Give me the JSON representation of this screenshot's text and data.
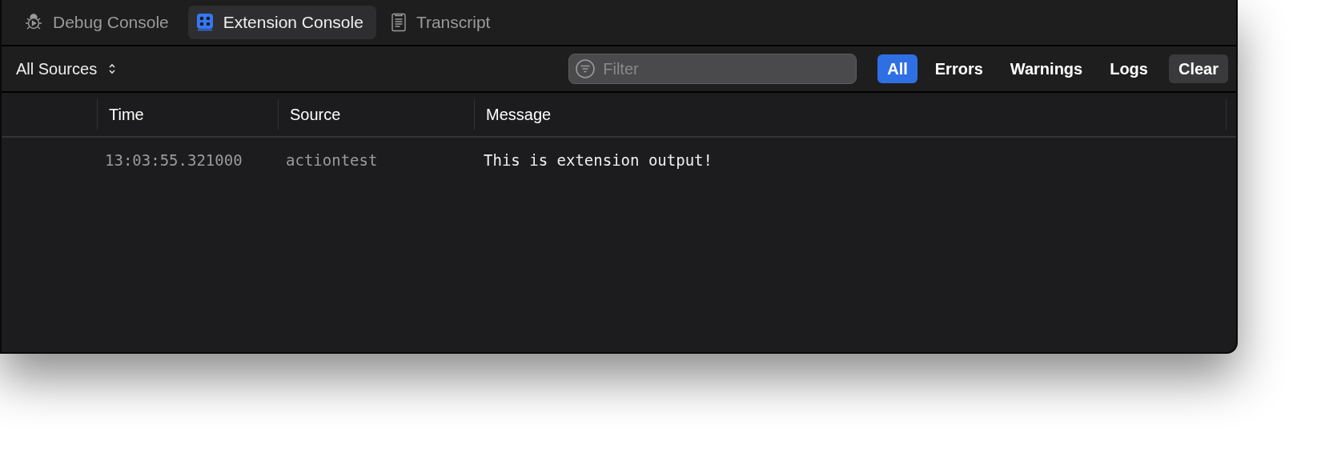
{
  "tabs": [
    {
      "label": "Debug Console",
      "kind": "bug",
      "selected": false
    },
    {
      "label": "Extension Console",
      "kind": "extension",
      "selected": true
    },
    {
      "label": "Transcript",
      "kind": "document",
      "selected": false
    }
  ],
  "toolbar": {
    "source_menu": "All Sources",
    "filter": {
      "placeholder": "Filter"
    },
    "levels": [
      {
        "label": "All",
        "selected": true
      },
      {
        "label": "Errors",
        "selected": false
      },
      {
        "label": "Warnings",
        "selected": false
      },
      {
        "label": "Logs",
        "selected": false
      }
    ],
    "clear_button": "Clear"
  },
  "table": {
    "columns": [
      "Time",
      "Source",
      "Message"
    ],
    "rows": [
      {
        "time": "13:03:55.321000",
        "source": "actiontest",
        "message": "This is extension output!"
      }
    ]
  }
}
